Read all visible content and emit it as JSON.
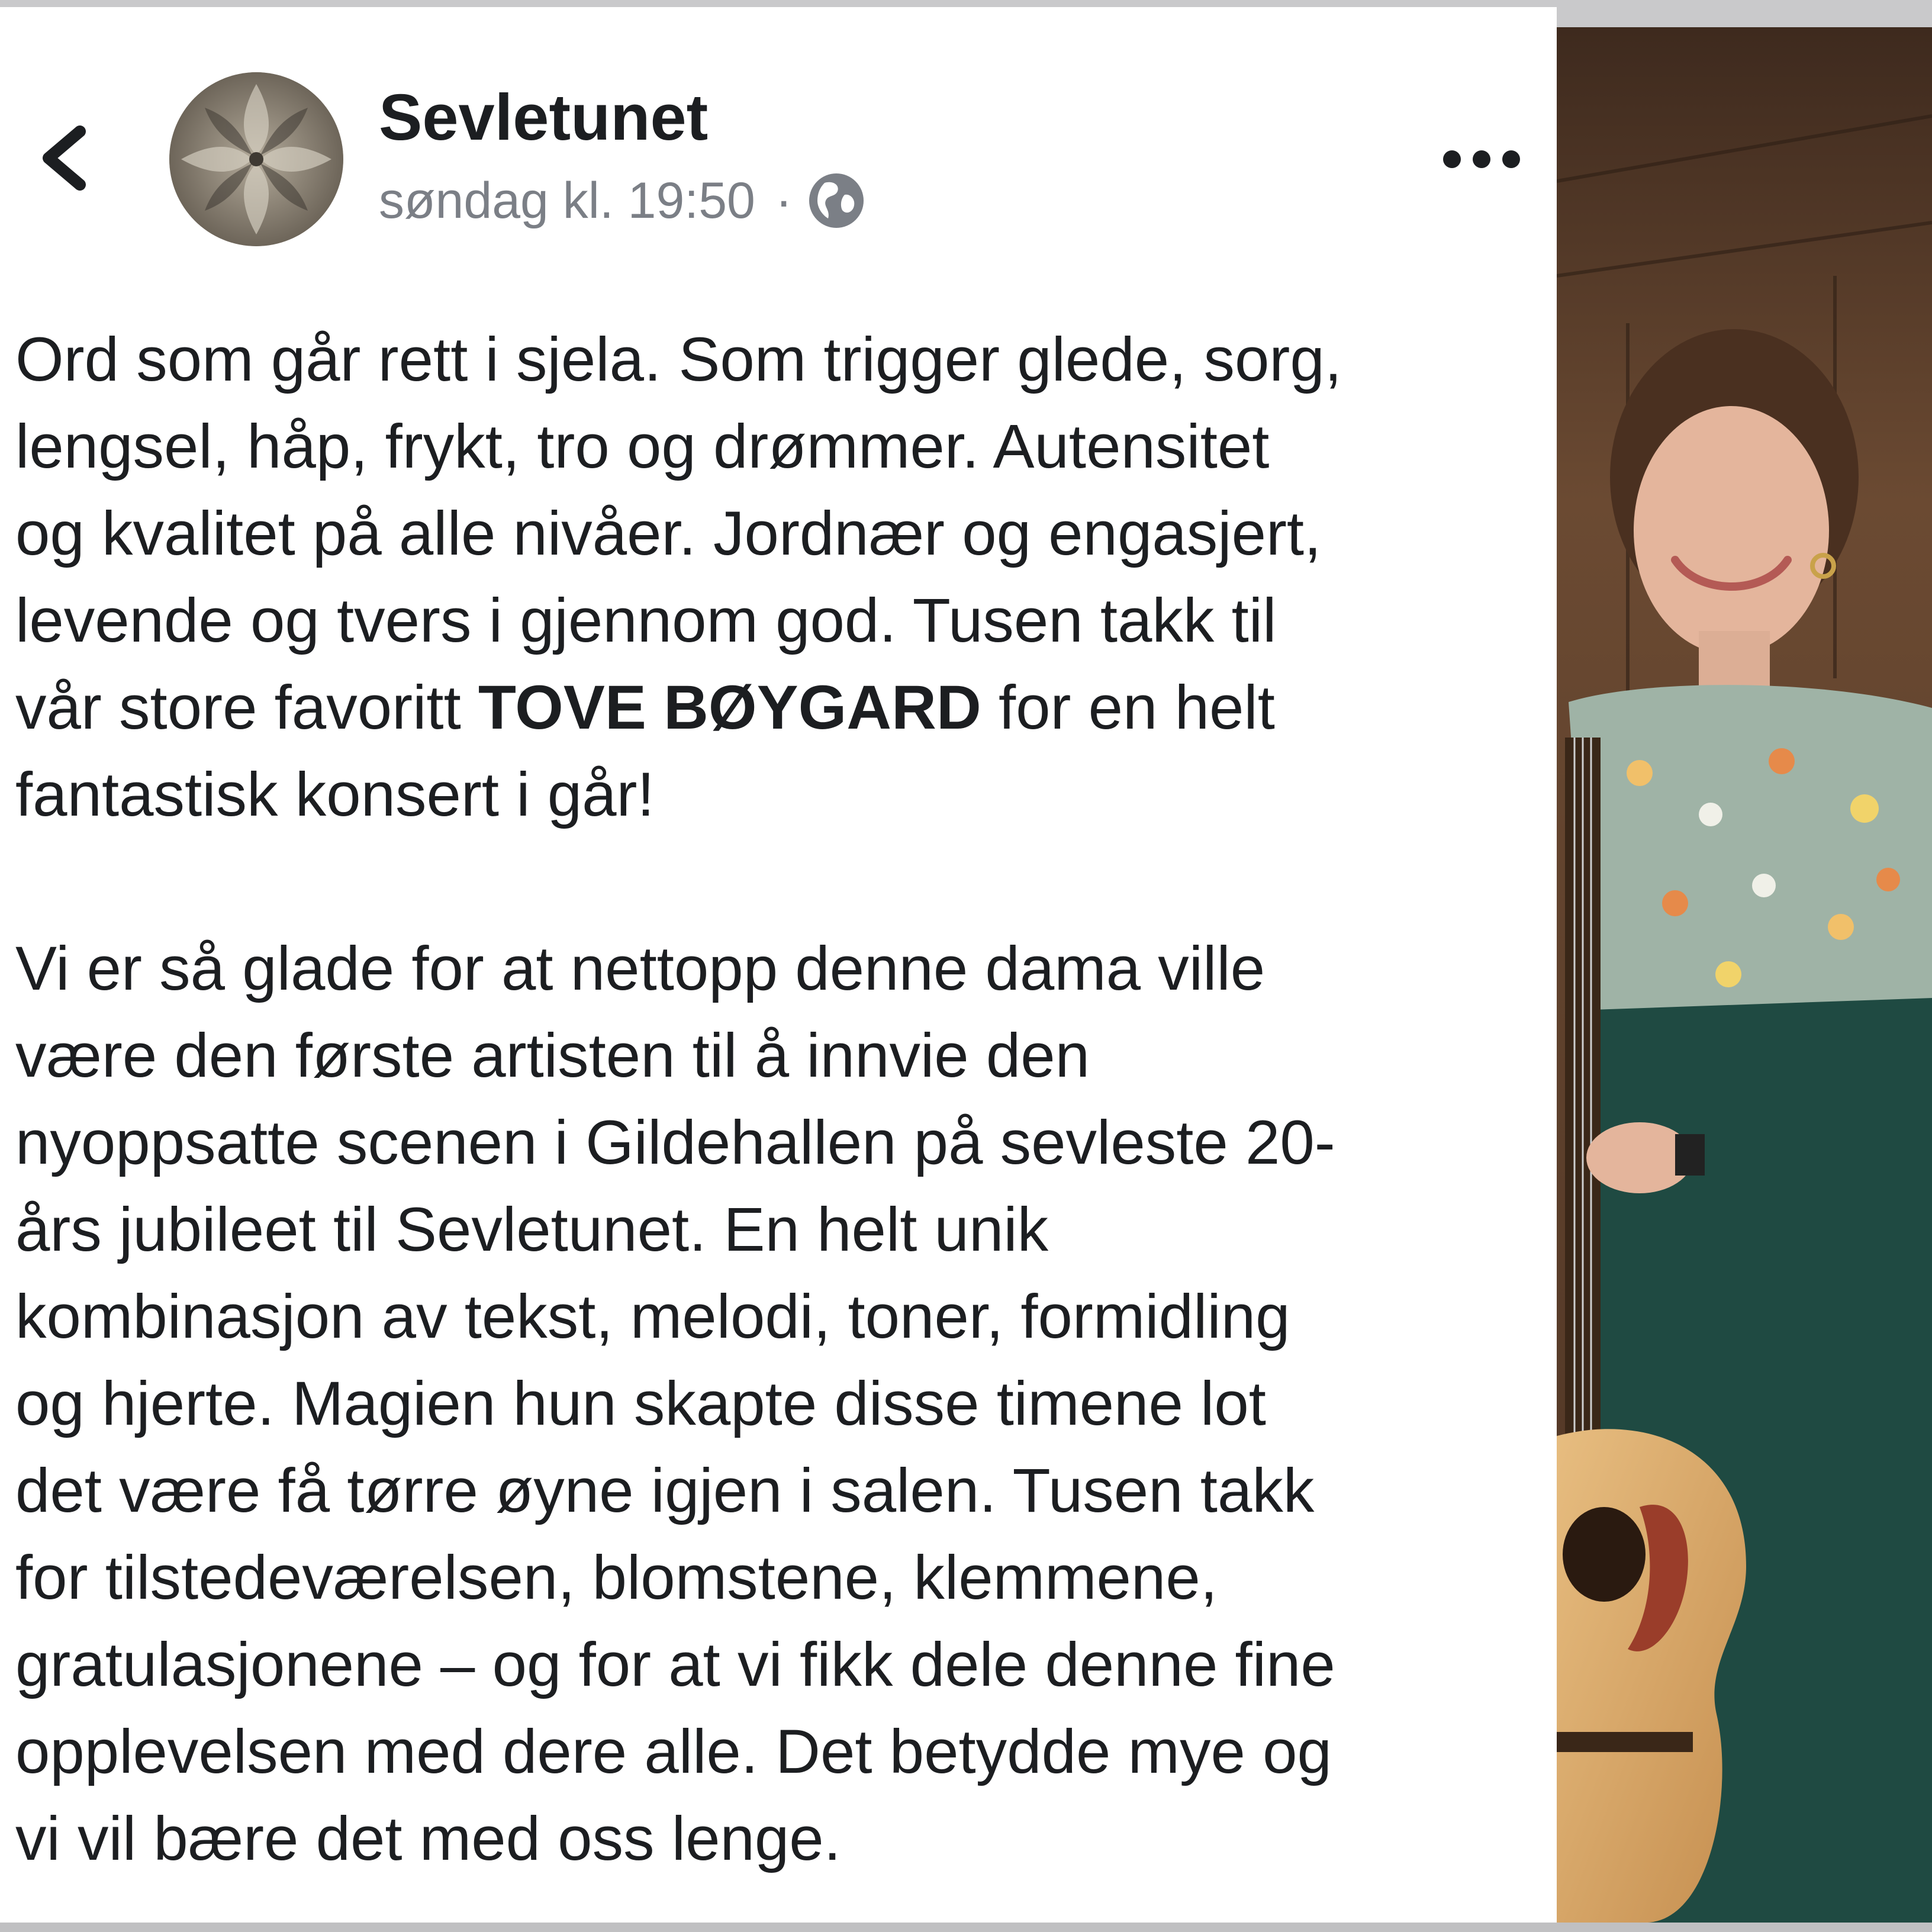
{
  "post": {
    "page_name": "Sevletunet",
    "timestamp": "søndag kl. 19:50",
    "separator": "·",
    "audience_icon": "globe-icon",
    "back_icon": "chevron-left-icon",
    "more_icon": "more-horizontal-icon",
    "avatar_icon": "carved-rosette-avatar",
    "paragraph1": {
      "lines": [
        "Ord som går rett i sjela. Som trigger glede, sorg,",
        "lengsel, håp, frykt, tro og drømmer. Autensitet",
        "og kvalitet på alle nivåer. Jordnær og engasjert,",
        "levende og tvers i gjennom god. Tusen takk til"
      ],
      "line5_before": "vår store favoritt ",
      "line5_bold": "TOVE BØYGARD",
      "line5_after": " for en helt",
      "line6": "fantastisk konsert i går!"
    },
    "paragraph2": {
      "lines": [
        "Vi er så glade for at nettopp denne dama ville",
        "være den første artisten til å innvie den",
        "nyoppsatte scenen i Gildehallen på sevleste 20-",
        "års jubileet til Sevletunet. En helt unik",
        "kombinasjon av tekst, melodi, toner, formidling",
        "og hjerte. Magien hun skapte disse timene lot",
        "det være få tørre øyne igjen i salen. Tusen takk",
        "for tilstedeværelsen, blomstene, klemmene,",
        "gratulasjonene – og for at vi fikk dele denne fine",
        "opplevelsen med dere alle. Det betydde mye og",
        "vi vil bære det med oss lenge."
      ]
    }
  },
  "photo": {
    "subject": "woman-with-acoustic-guitar",
    "colors": {
      "wood_wall": "#6b4a32",
      "blouse": "#9fb3a6",
      "skirt": "#1f4a42",
      "guitar_top": "#d9a868",
      "pickguard": "#9a3d2a"
    }
  }
}
